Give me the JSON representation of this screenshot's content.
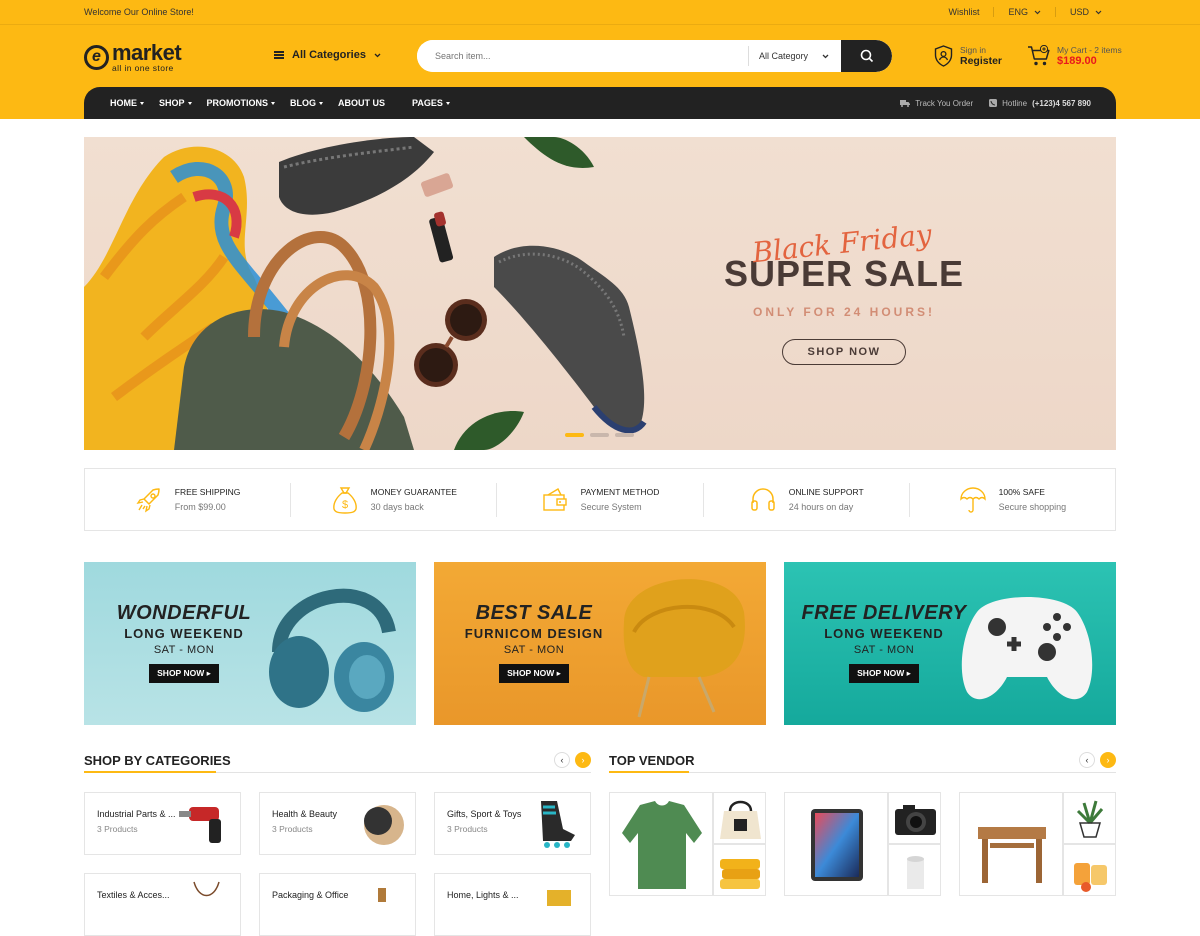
{
  "topbar": {
    "welcome": "Welcome Our Online Store!",
    "wishlist": "Wishlist",
    "language": "ENG",
    "currency": "USD"
  },
  "logo": {
    "letter": "e",
    "word": "market",
    "tagline": "all in one store"
  },
  "header": {
    "all_categories": "All Categories",
    "search_placeholder": "Search item...",
    "search_category": "All Category",
    "signin": "Sign in",
    "register": "Register",
    "cart_label": "My Cart - 2 items",
    "cart_total": "$189.00"
  },
  "nav": {
    "items": [
      {
        "label": "HOME",
        "dropdown": true
      },
      {
        "label": "SHOP",
        "dropdown": true
      },
      {
        "label": "PROMOTIONS",
        "dropdown": true
      },
      {
        "label": "BLOG",
        "dropdown": true
      },
      {
        "label": "ABOUT US",
        "dropdown": false
      },
      {
        "label": "PAGES",
        "dropdown": true
      }
    ],
    "track_order": "Track You Order",
    "hotline_label": "Hotline",
    "hotline_number": "(+123)4 567 890"
  },
  "hero": {
    "script": "Black Friday",
    "title": "SUPER SALE",
    "subtitle": "ONLY FOR 24 HOURS!",
    "button": "SHOP NOW",
    "slides": 3,
    "active_slide": 1
  },
  "features": [
    {
      "title": "FREE SHIPPING",
      "sub": "From $99.00",
      "icon": "rocket-icon"
    },
    {
      "title": "MONEY GUARANTEE",
      "sub": "30 days back",
      "icon": "money-bag-icon"
    },
    {
      "title": "PAYMENT METHOD",
      "sub": "Secure System",
      "icon": "wallet-icon"
    },
    {
      "title": "ONLINE SUPPORT",
      "sub": "24 hours on day",
      "icon": "headset-icon"
    },
    {
      "title": "100% SAFE",
      "sub": "Secure shopping",
      "icon": "umbrella-icon"
    }
  ],
  "promos": [
    {
      "line1": "WONDERFUL",
      "line2": "LONG WEEKEND",
      "line3": "SAT - MON",
      "button": "SHOP NOW"
    },
    {
      "line1": "BEST SALE",
      "line2": "FURNICOM DESIGN",
      "line3": "SAT - MON",
      "button": "SHOP NOW"
    },
    {
      "line1": "FREE DELIVERY",
      "line2": "LONG WEEKEND",
      "line3": "SAT - MON",
      "button": "SHOP NOW"
    }
  ],
  "categories_section": {
    "title": "SHOP BY CATEGORIES",
    "items": [
      {
        "name": "Industrial Parts & ...",
        "count": "3 Products"
      },
      {
        "name": "Health & Beauty",
        "count": "3 Products"
      },
      {
        "name": "Gifts, Sport & Toys",
        "count": "3 Products"
      },
      {
        "name": "Textiles & Acces...",
        "count": ""
      },
      {
        "name": "Packaging & Office",
        "count": ""
      },
      {
        "name": "Home, Lights & ...",
        "count": ""
      }
    ]
  },
  "vendor_section": {
    "title": "TOP VENDOR"
  },
  "colors": {
    "brand": "#fdb913",
    "dark": "#222222",
    "price": "#e8181d"
  }
}
